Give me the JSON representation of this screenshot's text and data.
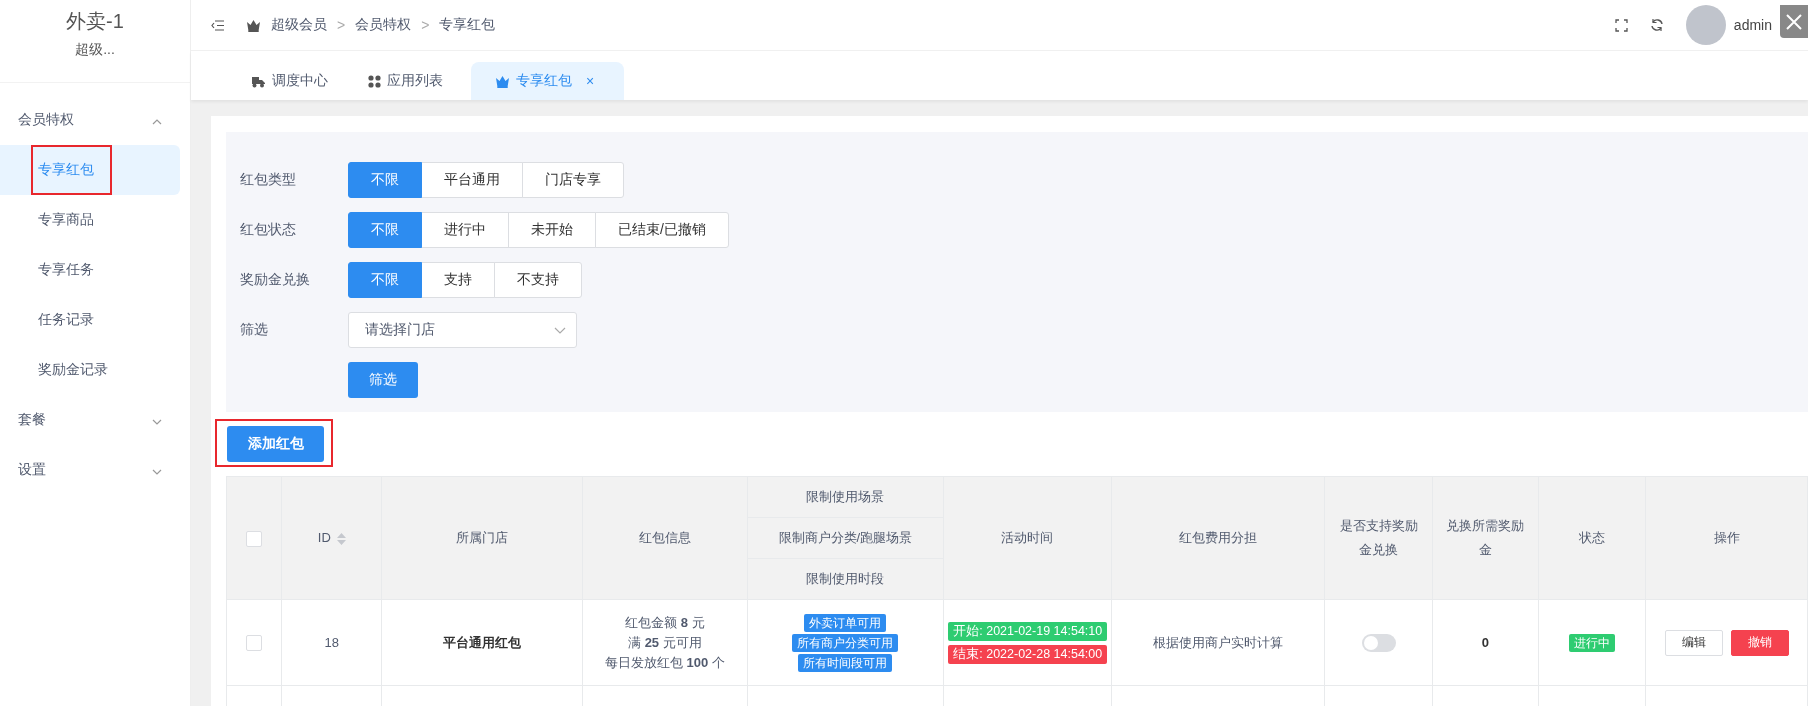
{
  "sidebar": {
    "title": "外卖-1",
    "subtitle": "超级...",
    "menu": [
      {
        "label": "会员特权",
        "expanded": true,
        "children": [
          {
            "label": "专享红包",
            "selected": true,
            "highlighted": true
          },
          {
            "label": "专享商品",
            "selected": false,
            "highlighted": false
          },
          {
            "label": "专享任务",
            "selected": false,
            "highlighted": false
          },
          {
            "label": "任务记录",
            "selected": false,
            "highlighted": false
          },
          {
            "label": "奖励金记录",
            "selected": false,
            "highlighted": false
          }
        ]
      },
      {
        "label": "套餐",
        "expanded": false
      },
      {
        "label": "设置",
        "expanded": false
      }
    ]
  },
  "header": {
    "breadcrumb": [
      "超级会员",
      "会员特权",
      "专享红包"
    ],
    "separators": [
      ">",
      ">"
    ],
    "user": "admin"
  },
  "tabs": [
    {
      "label": "调度中心",
      "selected": false,
      "closable": false
    },
    {
      "label": "应用列表",
      "selected": false,
      "closable": false
    },
    {
      "label": "专享红包",
      "selected": true,
      "closable": true,
      "close": "×"
    }
  ],
  "filters": [
    {
      "label": "红包类型",
      "kind": "segmented",
      "options": [
        {
          "label": "不限",
          "selected": true
        },
        {
          "label": "平台通用",
          "selected": false
        },
        {
          "label": "门店专享",
          "selected": false
        }
      ]
    },
    {
      "label": "红包状态",
      "kind": "segmented",
      "options": [
        {
          "label": "不限",
          "selected": true
        },
        {
          "label": "进行中",
          "selected": false
        },
        {
          "label": "未开始",
          "selected": false
        },
        {
          "label": "已结束/已撤销",
          "selected": false
        }
      ]
    },
    {
      "label": "奖励金兑换",
      "kind": "segmented",
      "options": [
        {
          "label": "不限",
          "selected": true
        },
        {
          "label": "支持",
          "selected": false
        },
        {
          "label": "不支持",
          "selected": false
        }
      ]
    },
    {
      "label": "筛选",
      "kind": "select",
      "placeholder": "请选择门店"
    }
  ],
  "filter_button": "筛选",
  "add_button": {
    "label": "添加红包",
    "highlighted": true
  },
  "table": {
    "select_all_checked": false,
    "columns": [
      {
        "label": "ID",
        "sortable": true
      },
      {
        "label": "所属门店"
      },
      {
        "label": "红包信息"
      },
      {
        "sub_labels": [
          "限制使用场景",
          "限制商户分类/跑腿场景",
          "限制使用时段"
        ]
      },
      {
        "label": "活动时间"
      },
      {
        "label": "红包费用分担"
      },
      {
        "label": "是否支持奖励金兑换"
      },
      {
        "label": "兑换所需奖励金"
      },
      {
        "label": "状态"
      },
      {
        "label": "操作"
      }
    ],
    "rows": [
      {
        "checked": false,
        "id": "18",
        "store": "平台通用红包",
        "info": [
          "红包金额 **8** 元",
          "满 **25** 元可用",
          "每日发放红包 **100** 个"
        ],
        "limits": [
          "外卖订单可用",
          "所有商户分类可用",
          "所有时间段可用"
        ],
        "times": [
          {
            "text": "开始: 2021-02-19 14:54:10",
            "color": "#2ecc71"
          },
          {
            "text": "结束: 2022-02-28 14:54:00",
            "color": "#f5424f"
          }
        ],
        "cost": "根据使用商户实时计算",
        "exchange_on": false,
        "points": "0",
        "status": {
          "text": "进行中",
          "color": "#2ecc71"
        },
        "actions": [
          {
            "label": "编辑",
            "kind": "default"
          },
          {
            "label": "撤销",
            "kind": "danger"
          }
        ]
      }
    ]
  }
}
